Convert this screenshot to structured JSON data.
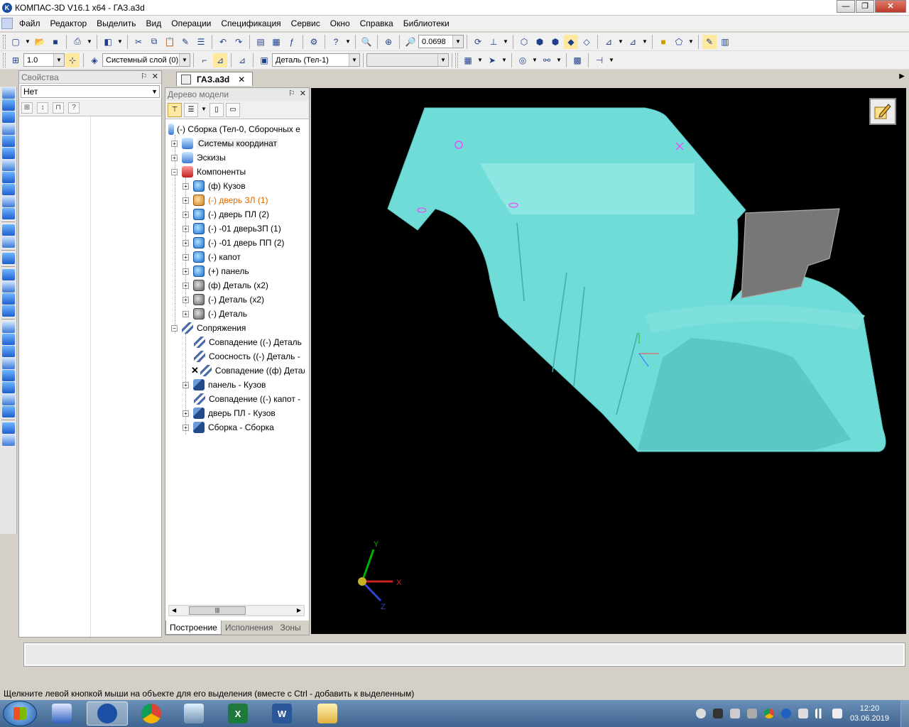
{
  "window": {
    "title": "КОМПАС-3D V16.1 x64 - ГАЗ.a3d",
    "app_icon_letter": "K",
    "minimize": "—",
    "maximize": "❐",
    "close": "✕"
  },
  "menu": [
    "Файл",
    "Редактор",
    "Выделить",
    "Вид",
    "Операции",
    "Спецификация",
    "Сервис",
    "Окно",
    "Справка",
    "Библиотеки"
  ],
  "toolbar1": {
    "zoom_value": "0.0698"
  },
  "toolbar2": {
    "line_step": "1.0",
    "layer": "Системный слой (0)",
    "detail": "Деталь (Тел-1)",
    "empty_combo": ""
  },
  "properties_panel": {
    "title": "Свойства",
    "selection": "Нет",
    "pin": "⚐",
    "close": "✕"
  },
  "doc_tab": {
    "label": "ГАЗ.a3d",
    "close": "✕"
  },
  "model_tree": {
    "title": "Дерево модели",
    "root": "(-) Сборка (Тел-0, Сборочных е",
    "groups": [
      "Системы координат",
      "Эскизы",
      "Компоненты"
    ],
    "components": [
      {
        "label": "(ф) Кузов",
        "highlight": false,
        "icon": "part"
      },
      {
        "label": "(-) дверь ЗЛ (1)",
        "highlight": true,
        "icon": "part-o"
      },
      {
        "label": "(-) дверь ПЛ (2)",
        "highlight": false,
        "icon": "part"
      },
      {
        "label": "(-) -01 дверьЗП (1)",
        "highlight": false,
        "icon": "part"
      },
      {
        "label": "(-) -01 дверь ПП (2)",
        "highlight": false,
        "icon": "part"
      },
      {
        "label": "(-) капот",
        "highlight": false,
        "icon": "part"
      },
      {
        "label": "(+) панель",
        "highlight": false,
        "icon": "part"
      },
      {
        "label": "(ф) Деталь (x2)",
        "highlight": false,
        "icon": "grey"
      },
      {
        "label": "(-) Деталь (x2)",
        "highlight": false,
        "icon": "grey"
      },
      {
        "label": "(-) Деталь",
        "highlight": false,
        "icon": "grey"
      }
    ],
    "mates_group": "Сопряжения",
    "mates": [
      {
        "label": "Совпадение ((-) Деталь",
        "error": false,
        "expandable": false
      },
      {
        "label": "Соосность ((-) Деталь  -",
        "error": false,
        "expandable": false
      },
      {
        "label": "Совпадение ((ф) Детал",
        "error": true,
        "expandable": false
      },
      {
        "label": "панель - Кузов",
        "error": false,
        "expandable": true
      },
      {
        "label": "Совпадение ((-) капот  -",
        "error": false,
        "expandable": false
      },
      {
        "label": "дверь ПЛ - Кузов",
        "error": false,
        "expandable": true
      },
      {
        "label": "Сборка - Сборка",
        "error": false,
        "expandable": true
      }
    ],
    "bottom_tabs": [
      "Построение",
      "Исполнения",
      "Зоны"
    ]
  },
  "viewport": {
    "axis_x": "X",
    "axis_y": "Y",
    "axis_z": "Z"
  },
  "status_text": "Щелкните левой кнопкой мыши на объекте для его выделения (вместе с Ctrl - добавить к выделенным)",
  "taskbar": {
    "time": "12:20",
    "date": "03.06.2019",
    "word_letter": "W",
    "excel_letter": "X"
  },
  "colors": {
    "model": "#6fdcd8",
    "viewport_bg": "#000000",
    "highlight": "#e06800"
  }
}
